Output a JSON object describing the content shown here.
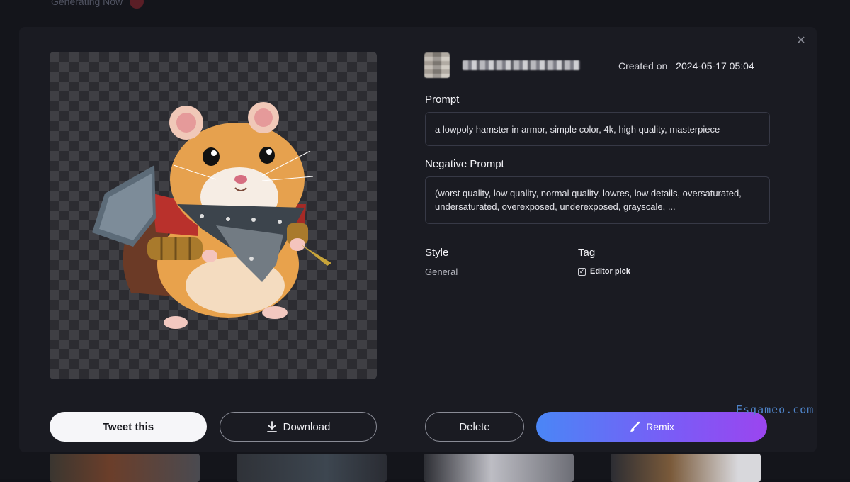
{
  "background": {
    "header_text": "Generating Now"
  },
  "modal": {
    "close_icon": "close-icon",
    "user": {
      "avatar_icon": "avatar-blurred",
      "username_blurred": true
    },
    "created": {
      "label": "Created on",
      "value": "2024-05-17 05:04"
    },
    "prompt": {
      "label": "Prompt",
      "value": "a lowpoly hamster in armor, simple color, 4k, high quality, masterpiece"
    },
    "negative_prompt": {
      "label": "Negative Prompt",
      "value": "(worst quality, low quality, normal quality, lowres, low details, oversaturated, undersaturated, overexposed, underexposed, grayscale, ..."
    },
    "style": {
      "label": "Style",
      "value": "General"
    },
    "tag": {
      "label": "Tag",
      "items": [
        {
          "label": "Editor pick",
          "checked": true
        }
      ]
    },
    "buttons": {
      "tweet_label": "Tweet this",
      "download_label": "Download",
      "delete_label": "Delete",
      "remix_label": "Remix"
    },
    "watermark": "Esgameo.com"
  },
  "colors": {
    "remix_gradient_start": "#4a86f6",
    "remix_gradient_end": "#9b45ef",
    "modal_bg": "#1a1b22",
    "page_bg": "#14151b"
  }
}
